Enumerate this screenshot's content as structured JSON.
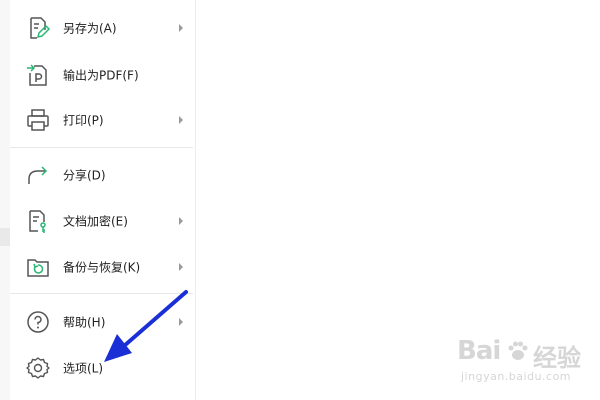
{
  "menu": {
    "items": [
      {
        "label": "另存为(A)",
        "icon": "save-as-icon",
        "has_submenu": true
      },
      {
        "label": "输出为PDF(F)",
        "icon": "export-pdf-icon",
        "has_submenu": false
      },
      {
        "label": "打印(P)",
        "icon": "print-icon",
        "has_submenu": true
      },
      {
        "label": "分享(D)",
        "icon": "share-icon",
        "has_submenu": false
      },
      {
        "label": "文档加密(E)",
        "icon": "document-encrypt-icon",
        "has_submenu": true
      },
      {
        "label": "备份与恢复(K)",
        "icon": "backup-restore-icon",
        "has_submenu": true
      },
      {
        "label": "帮助(H)",
        "icon": "help-icon",
        "has_submenu": true
      },
      {
        "label": "选项(L)",
        "icon": "gear-icon",
        "has_submenu": false
      }
    ]
  },
  "annotation": {
    "color": "#1b2fd6",
    "points_to": "选项(L)"
  },
  "watermark": {
    "brand": "Bai",
    "brand_cn": "经验",
    "url": "jingyan.baidu.com"
  }
}
